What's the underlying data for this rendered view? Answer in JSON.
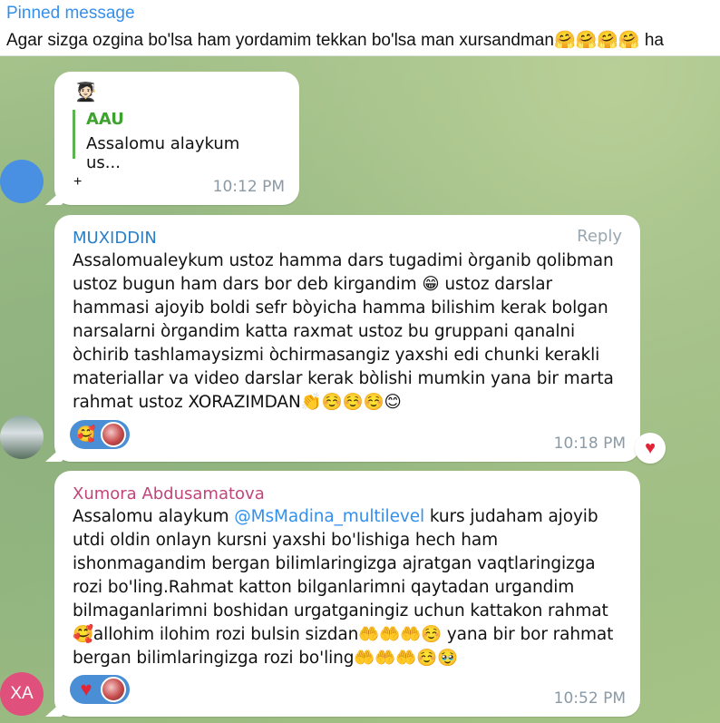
{
  "pinned": {
    "title": "Pinned message",
    "text": "Agar sizga ozgina bo'lsa ham yordamim tekkan bo'lsa man xursandman🤗🤗🤗🤗 ha"
  },
  "messages": [
    {
      "sender_icon": "🧑🏻‍🎓",
      "quote_name": "AAU",
      "quote_text": "Assalomu alaykum us...",
      "body": "+",
      "time": "10:12 PM"
    },
    {
      "sender": "MUXIDDIN",
      "reply_label": "Reply",
      "body": "Assalomualeykum ustoz hamma dars tugadimi òrganib qolibman ustoz bugun ham dars bor deb kirgandim 😁 ustoz darslar hammasi ajoyib boldi sefr bòyicha hamma bilishim kerak bolgan narsalarni òrgandim katta raxmat ustoz bu gruppani qanalni òchirib tashlamaysizmi òchirmasangiz yaxshi edi chunki kerakli materiallar va video darslar kerak bòlishi mumkin yana bir marta rahmat ustoz XORAZIMDAN👏☺️☺️☺️😊",
      "reaction_emoji": "🥰",
      "time": "10:18 PM",
      "badge": "♥"
    },
    {
      "sender": "Xumora Abdusamatova",
      "avatar_initials": "XA",
      "body_before": "Assalomu alaykum ",
      "mention": "@MsMadina_multilevel",
      "body_after": "  kurs judaham ajoyib utdi oldin onlayn kursni yaxshi bo'lishiga hech ham ishonmagandim bergan bilimlaringizga ajratgan vaqtlaringizga rozi bo'ling.Rahmat katton bilganlarimni qaytadan urgandim bilmaganlarimni boshidan urgatganingiz uchun kattakon rahmat 🥰allohim ilohim rozi bulsin sizdan🤲🤲🤲☺️ yana bir bor rahmat bergan bilimlaringizga rozi bo'ling🤲🤲🤲☺️🥹",
      "reaction_emoji": "♥",
      "time": "10:52 PM"
    }
  ],
  "colors": {
    "accent": "#3390ec",
    "sender_blue": "#2b7fc7",
    "sender_pink": "#c0457a",
    "quote_green": "#3ea32e",
    "reaction_blue": "#4a8fd6",
    "heart_red": "#e02636"
  }
}
